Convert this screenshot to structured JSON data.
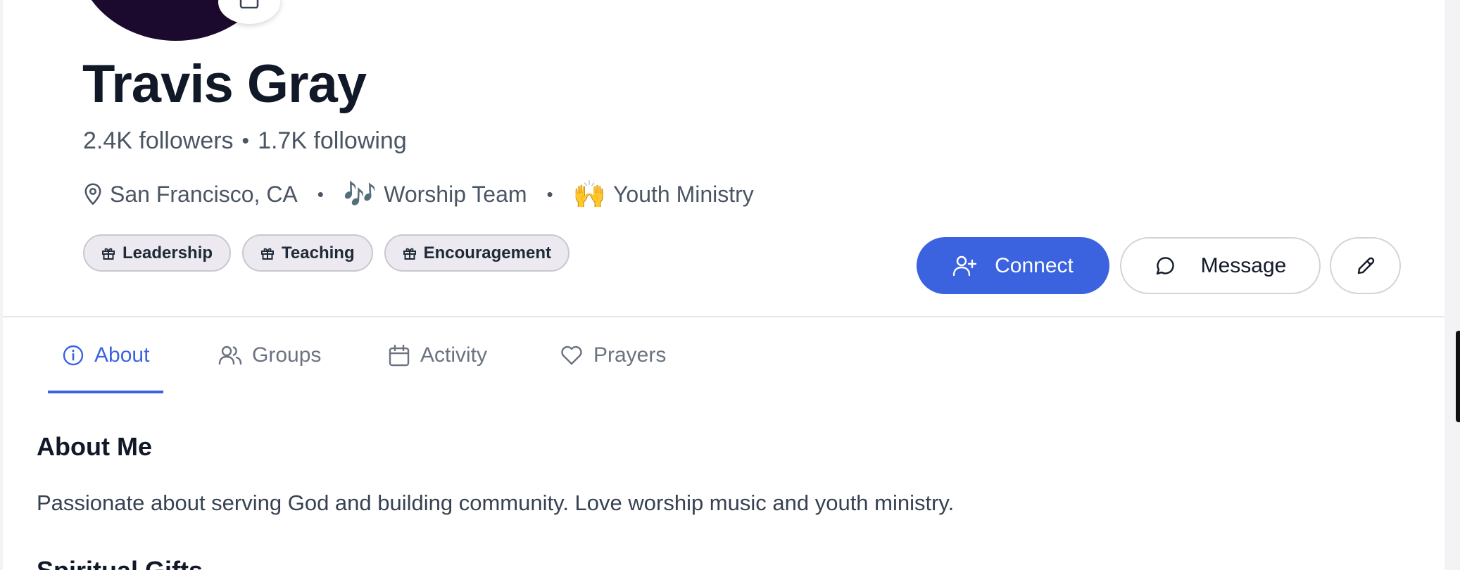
{
  "profile": {
    "name": "Travis Gray",
    "followers": "2.4K followers",
    "following": "1.7K following",
    "dot": "•",
    "location": "San Francisco, CA",
    "separator": "•",
    "ministries": [
      {
        "emoji": "🎶",
        "label": "Worship Team"
      },
      {
        "emoji": "🙌",
        "label": "Youth Ministry"
      }
    ],
    "gifts": [
      "Leadership",
      "Teaching",
      "Encouragement"
    ]
  },
  "actions": {
    "connect_label": "Connect",
    "message_label": "Message"
  },
  "tabs": [
    {
      "label": "About",
      "icon": "info-icon",
      "active": true
    },
    {
      "label": "Groups",
      "icon": "users-icon",
      "active": false
    },
    {
      "label": "Activity",
      "icon": "calendar-icon",
      "active": false
    },
    {
      "label": "Prayers",
      "icon": "heart-icon",
      "active": false
    }
  ],
  "about": {
    "title": "About Me",
    "bio": "Passionate about serving God and building community. Love worship music and youth ministry.",
    "next_section_title": "Spiritual Gifts"
  },
  "colors": {
    "accent": "#3b63e0",
    "avatar_bg": "#1c0a2e",
    "chip_bg": "#eceaf0"
  }
}
